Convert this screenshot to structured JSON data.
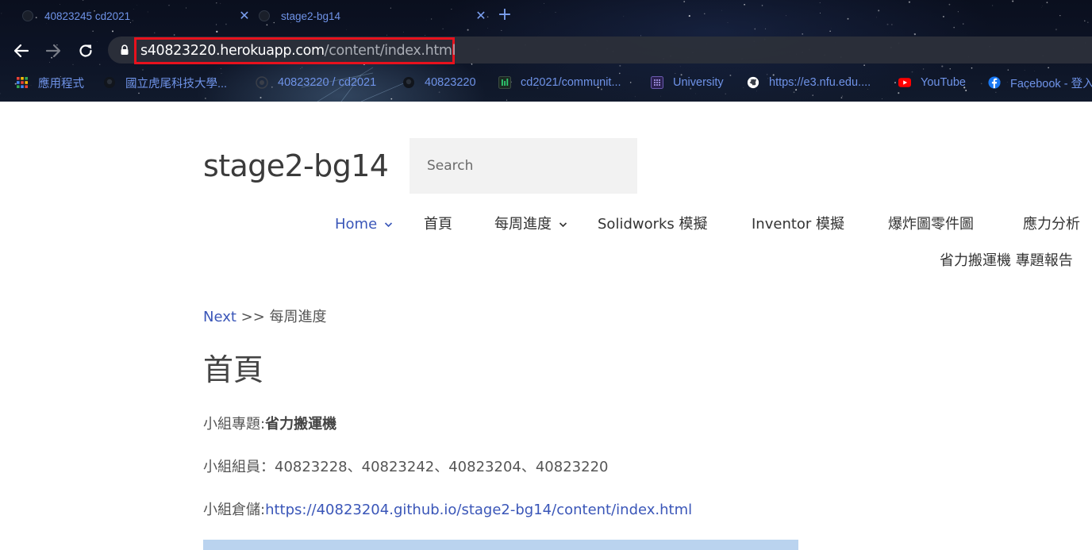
{
  "browser": {
    "tabs": [
      {
        "title": "40823245 cd2021",
        "close": "✕"
      },
      {
        "title": "stage2-bg14",
        "close": "✕"
      }
    ],
    "new_tab": "+",
    "url": {
      "host": "s40823220.herokuapp.com",
      "path": "/content/index.html"
    },
    "bookmarks": [
      {
        "label": "應用程式",
        "icon": "apps-grid-icon"
      },
      {
        "label": "國立虎尾科技大學...",
        "icon": "github-icon"
      },
      {
        "label": "40823220 / cd2021",
        "icon": "gitlab-icon"
      },
      {
        "label": "40823220",
        "icon": "github-icon"
      },
      {
        "label": "cd2021/communit...",
        "icon": "chart-icon"
      },
      {
        "label": "University",
        "icon": "university-icon"
      },
      {
        "label": "https://e3.nfu.edu....",
        "icon": "globe-icon"
      },
      {
        "label": "YouTube",
        "icon": "youtube-icon"
      },
      {
        "label": "Facebook - 登入",
        "icon": "facebook-icon"
      }
    ],
    "colors": {
      "highlight": "#e8111d",
      "link": "#6f93e8"
    }
  },
  "site": {
    "title": "stage2-bg14",
    "search_placeholder": "Search"
  },
  "nav": {
    "home": "Home",
    "first_page": "首頁",
    "weekly": "每周進度",
    "solidworks": "Solidworks 模擬",
    "inventor": "Inventor 模擬",
    "explode": "爆炸圖零件圖",
    "stress": "應力分析",
    "report": "省力搬運機 專題報告"
  },
  "content": {
    "next_link": "Next",
    "next_sep": " >> ",
    "next_target": "每周進度",
    "heading": "首頁",
    "topic_label": "小組專題:",
    "topic_value": "省力搬運機",
    "members": "小組組員：40823228、40823242、40823204、40823220",
    "repo_label": "小組倉儲:",
    "repo_url": "https://40823204.github.io/stage2-bg14/content/index.html"
  },
  "colors": {
    "accent": "#3a56b8",
    "block": "#bad3ef"
  }
}
